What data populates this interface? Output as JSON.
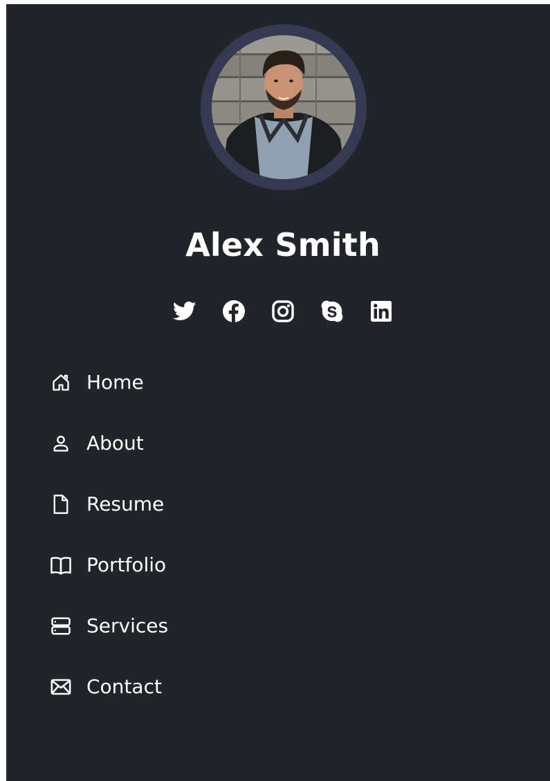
{
  "profile": {
    "name": "Alex Smith",
    "photo": "profile-photo"
  },
  "socials": [
    {
      "name": "twitter",
      "icon": "twitter-icon"
    },
    {
      "name": "facebook",
      "icon": "facebook-icon"
    },
    {
      "name": "instagram",
      "icon": "instagram-icon"
    },
    {
      "name": "skype",
      "icon": "skype-icon"
    },
    {
      "name": "linkedin",
      "icon": "linkedin-icon"
    }
  ],
  "nav": {
    "items": [
      {
        "label": "Home",
        "icon": "house-icon"
      },
      {
        "label": "About",
        "icon": "person-icon"
      },
      {
        "label": "Resume",
        "icon": "file-icon"
      },
      {
        "label": "Portfolio",
        "icon": "book-icon"
      },
      {
        "label": "Services",
        "icon": "server-icon"
      },
      {
        "label": "Contact",
        "icon": "envelope-icon"
      }
    ]
  },
  "colors": {
    "sidebar_bg": "#212429",
    "avatar_ring": "#353a52",
    "text": "#ffffff"
  }
}
